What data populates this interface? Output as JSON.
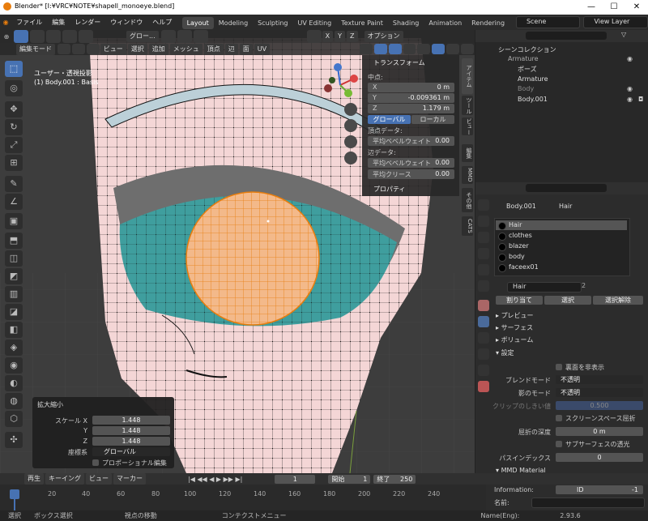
{
  "window": {
    "title": "Blender* [I:¥VRC¥NOTE¥shapell_monoeye.blend]",
    "minimize": "—",
    "maximize": "☐",
    "close": "✕"
  },
  "menubar": {
    "items": [
      "ファイル",
      "編集",
      "レンダー",
      "ウィンドウ",
      "ヘルプ"
    ],
    "workspaces": [
      "Layout",
      "Modeling",
      "Sculpting",
      "UV Editing",
      "Texture Paint",
      "Shading",
      "Animation",
      "Rendering"
    ],
    "active_workspace": "Layout",
    "scene": "Scene",
    "view_layer": "View Layer"
  },
  "viewport": {
    "mode": "編集モード",
    "header_menus": [
      "ビュー",
      "選択",
      "追加",
      "メッシュ",
      "頂点",
      "辺",
      "面",
      "UV"
    ],
    "transform_orientation": "グロー...",
    "options": "オプション",
    "axes": [
      "X",
      "Y",
      "Z"
    ],
    "overlay_line1": "ユーザー・透視投影",
    "overlay_line2": "(1) Body.001 : Basis"
  },
  "npanel": {
    "header": "トランスフォーム",
    "median_label": "中点:",
    "x_label": "X",
    "x_value": "0 m",
    "y_label": "Y",
    "y_value": "-0.009361 m",
    "z_label": "Z",
    "z_value": "1.179 m",
    "global_btn": "グローバル",
    "local_btn": "ローカル",
    "vertex_data": "頂点データ:",
    "vertex_bevel_label": "平均ベベルウェイト",
    "vertex_bevel_value": "0.00",
    "edge_data": "辺データ:",
    "edge_bevel_label": "平均ベベルウェイト",
    "edge_bevel_value": "0.00",
    "crease_label": "平均クリース",
    "crease_value": "0.00",
    "properties": "プロパティ",
    "tabs": [
      "アイテム",
      "ツール",
      "ビュー",
      "編集",
      "MMD",
      "その他",
      "CATS"
    ]
  },
  "op_panel": {
    "title": "拡大縮小",
    "scale_label": "スケール X",
    "y_label": "Y",
    "z_label": "Z",
    "scale_x": "1.448",
    "scale_y": "1.448",
    "scale_z": "1.448",
    "orientation_label": "座標系",
    "orientation_value": "グローバル",
    "proportional": "プロポーショナル編集"
  },
  "outliner": {
    "title": "シーンコレクション",
    "items": [
      {
        "name": "Armature"
      },
      {
        "name": "ポーズ"
      },
      {
        "name": "Armature"
      },
      {
        "name": "Body"
      },
      {
        "name": "Body.001"
      }
    ]
  },
  "properties": {
    "object": "Body.001",
    "material": "Hair",
    "slots": [
      "Hair",
      "clothes",
      "blazer",
      "body",
      "faceex01"
    ],
    "mat_name": "Hair",
    "users": "2",
    "assign": "割り当て",
    "select": "選択",
    "deselect": "選択解除",
    "sections": [
      "プレビュー",
      "サーフェス",
      "ボリューム",
      "設定"
    ],
    "backface": "裏面を非表示",
    "blend_mode_label": "ブレンドモード",
    "blend_mode_value": "不透明",
    "shadow_mode_label": "影のモード",
    "shadow_mode_value": "不透明",
    "clip_label": "クリップのしきい値",
    "clip_value": "0.500",
    "ssr": "スクリーンスペース屈折",
    "refr_depth_label": "屈折の深度",
    "refr_depth_value": "0 m",
    "sss": "サブサーフェスの透光",
    "pass_index_label": "パスインデックス",
    "pass_index_value": "0",
    "mmd_material": "MMD Material",
    "information_label": "Information:",
    "info_id": "ID",
    "info_value": "-1",
    "name_label": "名前:",
    "name_en_label": "Name(Eng):"
  },
  "timeline": {
    "playback": "再生",
    "keying": "キーイング",
    "view": "ビュー",
    "marker": "マーカー",
    "current_frame": "1",
    "start_label": "開始",
    "start": "1",
    "end_label": "終了",
    "end": "250",
    "ticks": [
      "1",
      "20",
      "40",
      "60",
      "80",
      "100",
      "120",
      "140",
      "160",
      "180",
      "200",
      "220",
      "240"
    ]
  },
  "statusbar": {
    "select": "選択",
    "box_select": "ボックス選択",
    "rotate_view": "視点の移動",
    "context_menu": "コンテクストメニュー",
    "version": "2.93.6"
  }
}
